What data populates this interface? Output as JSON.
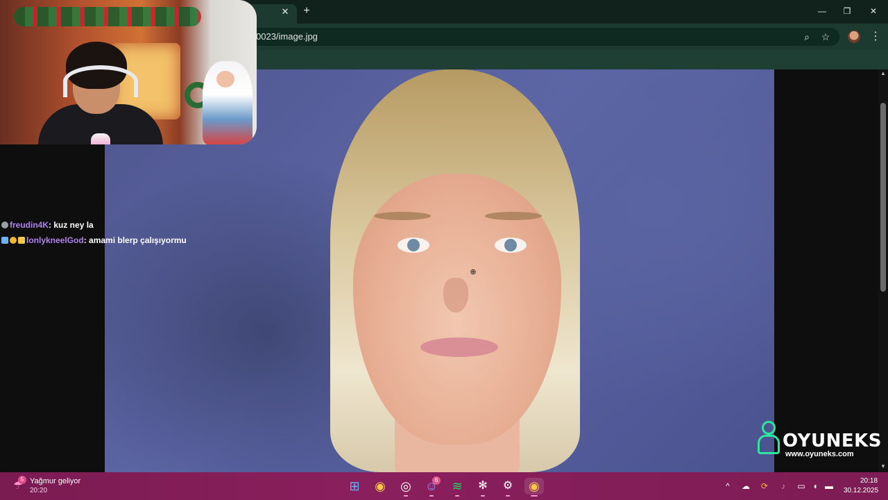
{
  "browser": {
    "url_fragment": "0023/image.jpg",
    "tab_close": "✕",
    "new_tab": "+",
    "window_controls": {
      "minimize": "—",
      "restore": "❐",
      "close": "✕"
    },
    "toolbar_icons": {
      "zoom": "zoom-icon",
      "bookmark": "star-icon",
      "profile": "avatar",
      "menu": "kebab-menu-icon"
    }
  },
  "chat": {
    "messages": [
      {
        "user": "freudin4K",
        "text": ": kuz ney la",
        "badge_colors": [
          "#9aa0a6"
        ]
      },
      {
        "user": "lonlykneelGod",
        "text": ": amami blerp çalışıyormu",
        "badge_colors": [
          "#6fb3ff",
          "#f2b632",
          "#f2c94c"
        ]
      }
    ]
  },
  "overlay_logo": {
    "name": "OYUNEKS",
    "url": "www.oyuneks.com",
    "accent": "#2ee59d"
  },
  "taskbar": {
    "weather": {
      "title": "Yağmur geliyor",
      "time": "20:20",
      "badge": "5"
    },
    "apps": [
      {
        "name": "windows-start",
        "glyph": "⊞",
        "active": false
      },
      {
        "name": "chrome",
        "glyph": "◉",
        "active": false
      },
      {
        "name": "obs",
        "glyph": "◎",
        "active": false
      },
      {
        "name": "discord",
        "glyph": "☺",
        "active": false,
        "badge": "6"
      },
      {
        "name": "spotify",
        "glyph": "≋",
        "active": false
      },
      {
        "name": "steelseries",
        "glyph": "✻",
        "active": false
      },
      {
        "name": "steam",
        "glyph": "⚙",
        "active": false
      },
      {
        "name": "chrome-profile",
        "glyph": "◉",
        "active": true
      }
    ],
    "tray": {
      "chevron": "^",
      "clock_time": "20:18",
      "clock_date": "30.12.2025"
    }
  },
  "colors": {
    "chrome_dark": "#10221b",
    "chrome_toolbar": "#1c3a2f",
    "taskbar": "#7a1b52",
    "chat_user": "#b083f0"
  }
}
